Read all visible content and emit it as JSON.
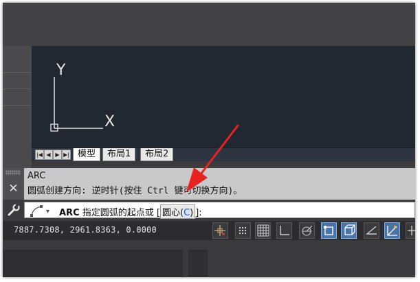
{
  "ucs": {
    "y_label": "Y",
    "x_label": "X"
  },
  "layout_tabs": {
    "nav_buttons": [
      "|◀",
      "◀",
      "▶",
      "▶|"
    ],
    "model": "模型",
    "layout1": "布局1",
    "layout2": "布局2"
  },
  "history": {
    "line1": "ARC",
    "line2": "圆弧创建方向: 逆时针(按住 Ctrl 键可切换方向)。",
    "close_symbol": "✕"
  },
  "command_line": {
    "command": "ARC",
    "prompt": "指定圆弧的起点或",
    "option_open": "[",
    "option_label": "圆心(",
    "option_key": "C",
    "option_close": ")",
    "bracket_close": "]:",
    "dropdown_arrow": "▾"
  },
  "status_bar": {
    "coordinates": "7887.7308, 2961.8363, 0.0000",
    "toggles": [
      {
        "name": "infer-constraints",
        "on": false
      },
      {
        "name": "snap-mode",
        "on": false
      },
      {
        "name": "grid-display",
        "on": false
      },
      {
        "name": "ortho-mode",
        "on": false
      },
      {
        "name": "polar-tracking",
        "on": false
      },
      {
        "name": "object-snap",
        "on": true
      },
      {
        "name": "3d-object-snap",
        "on": true
      },
      {
        "name": "object-snap-tracking",
        "on": false
      },
      {
        "name": "dynamic-ucs",
        "on": false
      },
      {
        "name": "dynamic-input",
        "on": false
      }
    ]
  },
  "colors": {
    "viewport_bg": "#212832",
    "arrow": "#e8231f",
    "toggle_on": "#4b74a6"
  }
}
